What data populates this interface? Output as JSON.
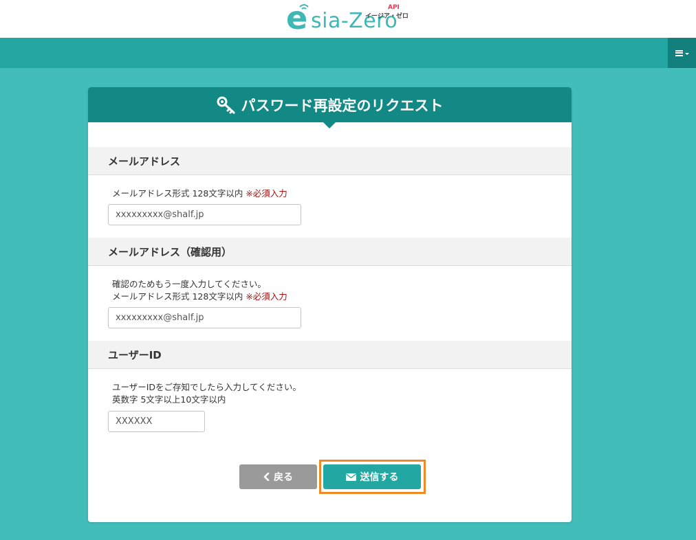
{
  "header": {
    "logo": {
      "mark": "e",
      "wordmark": "sia-Zero",
      "api_badge": "API",
      "kana": "イージア・ゼロ"
    }
  },
  "nav": {
    "menu_icon": "hamburger-icon"
  },
  "card": {
    "title": "パスワード再設定のリクエスト",
    "title_icon": "key-icon",
    "sections": [
      {
        "heading": "メールアドレス",
        "hint_lines": [
          "メールアドレス形式 128文字以内"
        ],
        "required": "※必須入力",
        "placeholder": "xxxxxxxxx@shalf.jp"
      },
      {
        "heading": "メールアドレス（確認用）",
        "hint_lines": [
          "確認のためもう一度入力してください。",
          "メールアドレス形式 128文字以内"
        ],
        "required": "※必須入力",
        "placeholder": "xxxxxxxxx@shalf.jp"
      },
      {
        "heading": "ユーザーID",
        "hint_lines": [
          "ユーザーIDをご存知でしたら入力してください。",
          "英数字 5文字以上10文字以内"
        ],
        "placeholder": "XXXXXX"
      }
    ],
    "buttons": {
      "back": "戻る",
      "submit": "送信する"
    }
  },
  "colors": {
    "page_bg": "#43bdba",
    "nav_bar": "#23a5a2",
    "card_header": "#128985",
    "required_text": "#a81414",
    "highlight_frame": "#f08a24",
    "submit_button": "#22a7a3",
    "back_button": "#9a9a9a"
  }
}
